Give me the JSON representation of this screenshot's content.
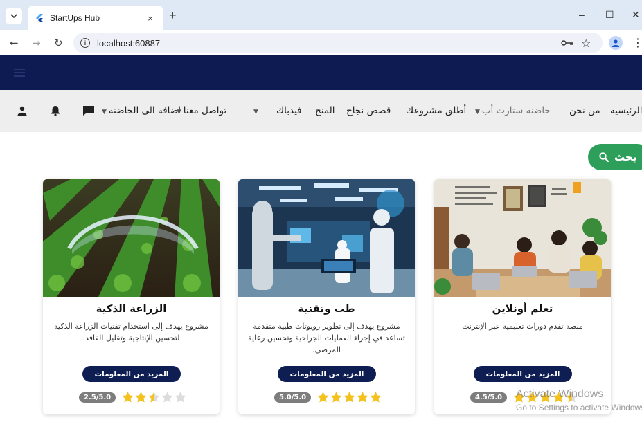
{
  "browser": {
    "tab_title": "StartUps Hub",
    "tab_close": "×",
    "new_tab": "+",
    "url": "localhost:60887",
    "win_minimize": "–",
    "win_maximize": "☐",
    "win_close": "✕"
  },
  "nav": {
    "items": [
      {
        "label": "الرئيسية"
      },
      {
        "label": "من نحن"
      },
      {
        "label": "حاضنة ستارت أب",
        "dropdown": true
      },
      {
        "label": "أطلق مشروعك"
      },
      {
        "label": "قصص نجاح"
      },
      {
        "label": "المنح"
      },
      {
        "label": "فيدباك",
        "dropdown": true
      },
      {
        "label": "تواصل معنا",
        "dropdown": true
      },
      {
        "label": "اضافة الى الحاضنة",
        "dropdown": true
      }
    ],
    "icons": [
      "chat-icon",
      "bell-icon",
      "user-icon"
    ]
  },
  "search": {
    "label": "بحث"
  },
  "cards": [
    {
      "title": "تعلم أونلاين",
      "description": "منصة تقدم دورات تعليمية عبر الإنترنت",
      "button": "المزيد من المعلومات",
      "rating_text": "4.5/5.0",
      "rating": 4.5
    },
    {
      "title": "طب وتقنية",
      "description": "مشروع يهدف إلى تطوير روبوتات طبية متقدمة تساعد في إجراء العمليات الجراحية وتحسين رعاية المرضى.",
      "button": "المزيد من المعلومات",
      "rating_text": "5.0/5.0",
      "rating": 5.0
    },
    {
      "title": "الزراعة الذكية",
      "description": "مشروع يهدف إلى استخدام تقنيات الزراعة الذكية لتحسين الإنتاجية وتقليل الفاقد.",
      "button": "المزيد من المعلومات",
      "rating_text": "2.5/5.0",
      "rating": 2.5
    }
  ],
  "watermark": {
    "line1": "Activate Windows",
    "line2": "Go to Settings to activate Windows."
  },
  "colors": {
    "header": "#0d1b52",
    "navbar": "#eeeeee",
    "button": "#0f1e52",
    "search": "#2e9e5b",
    "star": "#f4c21b"
  }
}
